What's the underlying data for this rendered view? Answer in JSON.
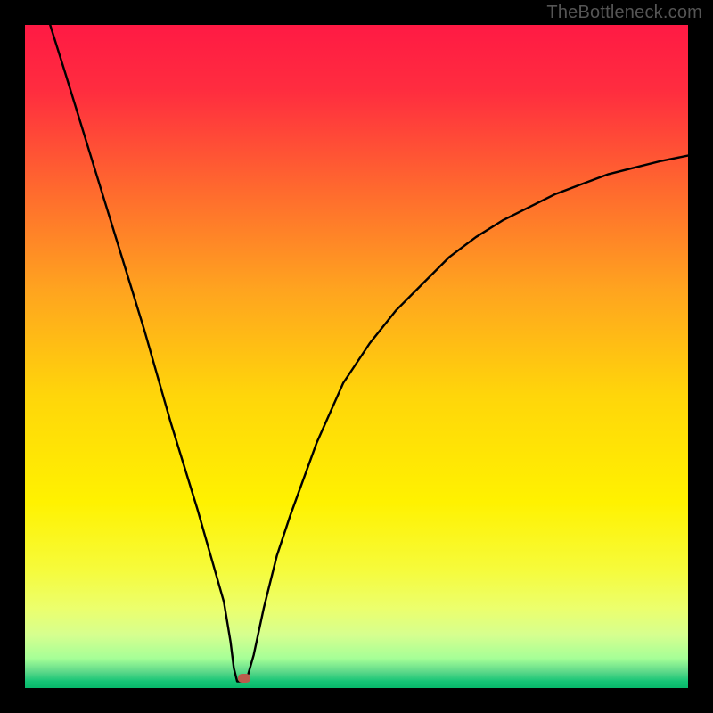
{
  "watermark": "TheBottleneck.com",
  "chart_data": {
    "type": "line",
    "title": "",
    "xlabel": "",
    "ylabel": "",
    "xlim": [
      0,
      100
    ],
    "ylim": [
      0,
      100
    ],
    "grid": false,
    "series": [
      {
        "name": "curve",
        "x": [
          3.8,
          6,
          10,
          14,
          18,
          22,
          26,
          28,
          30,
          31,
          31.5,
          32,
          33,
          33.5,
          34.5,
          36,
          38,
          40,
          44,
          48,
          52,
          56,
          60,
          64,
          68,
          72,
          76,
          80,
          84,
          88,
          92,
          96,
          100
        ],
        "y": [
          100,
          93,
          80,
          67,
          54,
          40,
          27,
          20,
          13,
          7,
          3,
          1,
          1,
          1.5,
          5,
          12,
          20,
          26,
          37,
          46,
          52,
          57,
          61,
          65,
          68,
          70.5,
          72.5,
          74.5,
          76,
          77.5,
          78.5,
          79.5,
          80.3
        ]
      }
    ],
    "background_gradient": {
      "stops": [
        {
          "pos": 0.0,
          "color": "#ff1a44"
        },
        {
          "pos": 0.1,
          "color": "#ff2d3f"
        },
        {
          "pos": 0.25,
          "color": "#ff6a2e"
        },
        {
          "pos": 0.4,
          "color": "#ffa41f"
        },
        {
          "pos": 0.56,
          "color": "#ffd60a"
        },
        {
          "pos": 0.72,
          "color": "#fff200"
        },
        {
          "pos": 0.82,
          "color": "#f6fb3a"
        },
        {
          "pos": 0.88,
          "color": "#ecff6d"
        },
        {
          "pos": 0.92,
          "color": "#d6ff8f"
        },
        {
          "pos": 0.955,
          "color": "#a6ff97"
        },
        {
          "pos": 0.975,
          "color": "#5fd98a"
        },
        {
          "pos": 0.99,
          "color": "#15c476"
        },
        {
          "pos": 1.0,
          "color": "#08b86b"
        }
      ]
    },
    "marker": {
      "x": 33,
      "y": 1.5,
      "color": "#bb5b4c"
    },
    "frame_color": "#000000",
    "curve_color": "#000000"
  }
}
